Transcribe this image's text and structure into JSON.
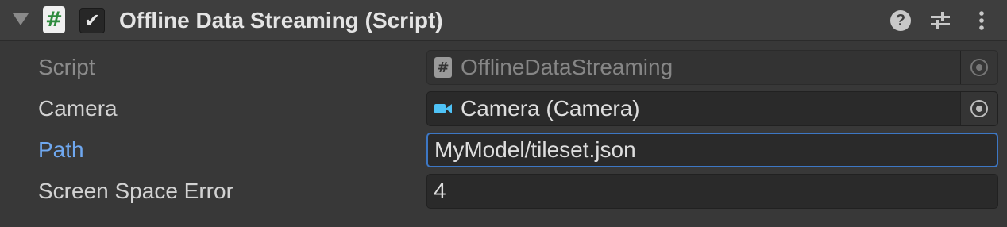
{
  "component": {
    "title": "Offline Data Streaming (Script)",
    "enabled": true,
    "script_badge": "#",
    "checkbox_glyph": "✔",
    "help_glyph": "?"
  },
  "properties": [
    {
      "label": "Script",
      "value": "OfflineDataStreaming",
      "icon": "script-icon",
      "state": "disabled"
    },
    {
      "label": "Camera",
      "value": "Camera (Camera)",
      "icon": "camera-icon",
      "state": "normal"
    },
    {
      "label": "Path",
      "value": "MyModel/tileset.json",
      "state": "focused"
    },
    {
      "label": "Screen Space Error",
      "value": "4",
      "state": "normal"
    }
  ],
  "colors": {
    "background": "#383838",
    "header": "#3e3e3e",
    "field": "#2a2a2a",
    "focus_border": "#3d77c4",
    "highlight_label": "#6fa8f0",
    "script_hash": "#2e8b3e",
    "camera_icon": "#4fc3f7"
  }
}
